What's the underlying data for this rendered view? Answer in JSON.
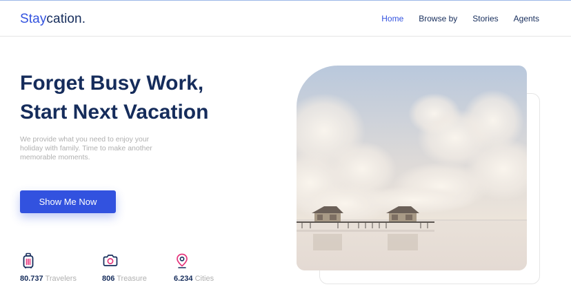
{
  "brand": {
    "accent_part": "Stay",
    "rest_part": "cation."
  },
  "nav": {
    "items": [
      {
        "label": "Home",
        "active": true
      },
      {
        "label": "Browse by",
        "active": false
      },
      {
        "label": "Stories",
        "active": false
      },
      {
        "label": "Agents",
        "active": false
      }
    ]
  },
  "hero": {
    "title_line1": "Forget Busy Work,",
    "title_line2": "Start Next Vacation",
    "description": "We provide what you need to enjoy your holiday with family. Time to make another memorable moments.",
    "cta_label": "Show Me Now"
  },
  "stats": [
    {
      "number": "80.737",
      "label": "Travelers",
      "icon": "luggage-icon"
    },
    {
      "number": "806",
      "label": "Treasure",
      "icon": "camera-icon"
    },
    {
      "number": "6.234",
      "label": "Cities",
      "icon": "location-pin-icon"
    }
  ],
  "colors": {
    "primary": "#3252df",
    "navy": "#152c5b",
    "gray_text": "#b0b0b0",
    "icon_pink": "#e5347b"
  }
}
